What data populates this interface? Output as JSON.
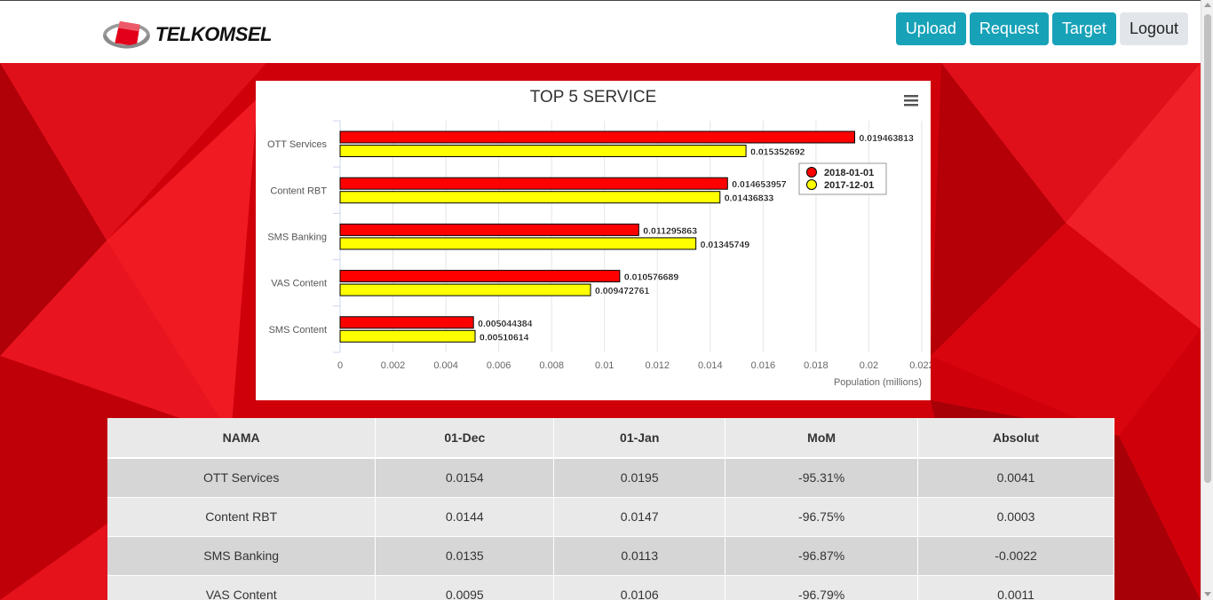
{
  "brand": {
    "name": "TELKOMSEL",
    "accent": "#e2001a"
  },
  "nav": {
    "upload": "Upload",
    "request": "Request",
    "target": "Target",
    "logout": "Logout"
  },
  "chart_menu_icon": "hamburger-menu-icon",
  "chart_data": {
    "type": "bar",
    "orientation": "horizontal",
    "title": "TOP 5 SERVICE",
    "xlabel": "Population (millions)",
    "ylabel": "",
    "categories": [
      "OTT Services",
      "Content RBT",
      "SMS Banking",
      "VAS Content",
      "SMS Content"
    ],
    "series": [
      {
        "name": "2018-01-01",
        "color": "#ff0000",
        "values": [
          0.019463813,
          0.014653957,
          0.011295863,
          0.010576689,
          0.005044384
        ],
        "labels": [
          "0.019463813",
          "0.014653957",
          "0.011295863",
          "0.010576689",
          "0.005044384"
        ]
      },
      {
        "name": "2017-12-01",
        "color": "#ffff00",
        "values": [
          0.015352692,
          0.01436833,
          0.01345749,
          0.009472761,
          0.00510614
        ],
        "labels": [
          "0.015352692",
          "0.01436833",
          "0.01345749",
          "0.009472761",
          "0.00510614"
        ]
      }
    ],
    "xlim": [
      0,
      0.022
    ],
    "xticks": [
      0,
      0.002,
      0.004,
      0.006,
      0.008,
      0.01,
      0.012,
      0.014,
      0.016,
      0.018,
      0.02,
      0.022
    ],
    "xtick_labels": [
      "0",
      "0.002",
      "0.004",
      "0.006",
      "0.008",
      "0.01",
      "0.012",
      "0.014",
      "0.016",
      "0.018",
      "0.02",
      "0.022"
    ],
    "grid": true,
    "legend": "top-right"
  },
  "table": {
    "headers": [
      "NAMA",
      "01-Dec",
      "01-Jan",
      "MoM",
      "Absolut"
    ],
    "rows": [
      [
        "OTT Services",
        "0.0154",
        "0.0195",
        "-95.31%",
        "0.0041"
      ],
      [
        "Content RBT",
        "0.0144",
        "0.0147",
        "-96.75%",
        "0.0003"
      ],
      [
        "SMS Banking",
        "0.0135",
        "0.0113",
        "-96.87%",
        "-0.0022"
      ],
      [
        "VAS Content",
        "0.0095",
        "0.0106",
        "-96.79%",
        "0.0011"
      ]
    ]
  }
}
